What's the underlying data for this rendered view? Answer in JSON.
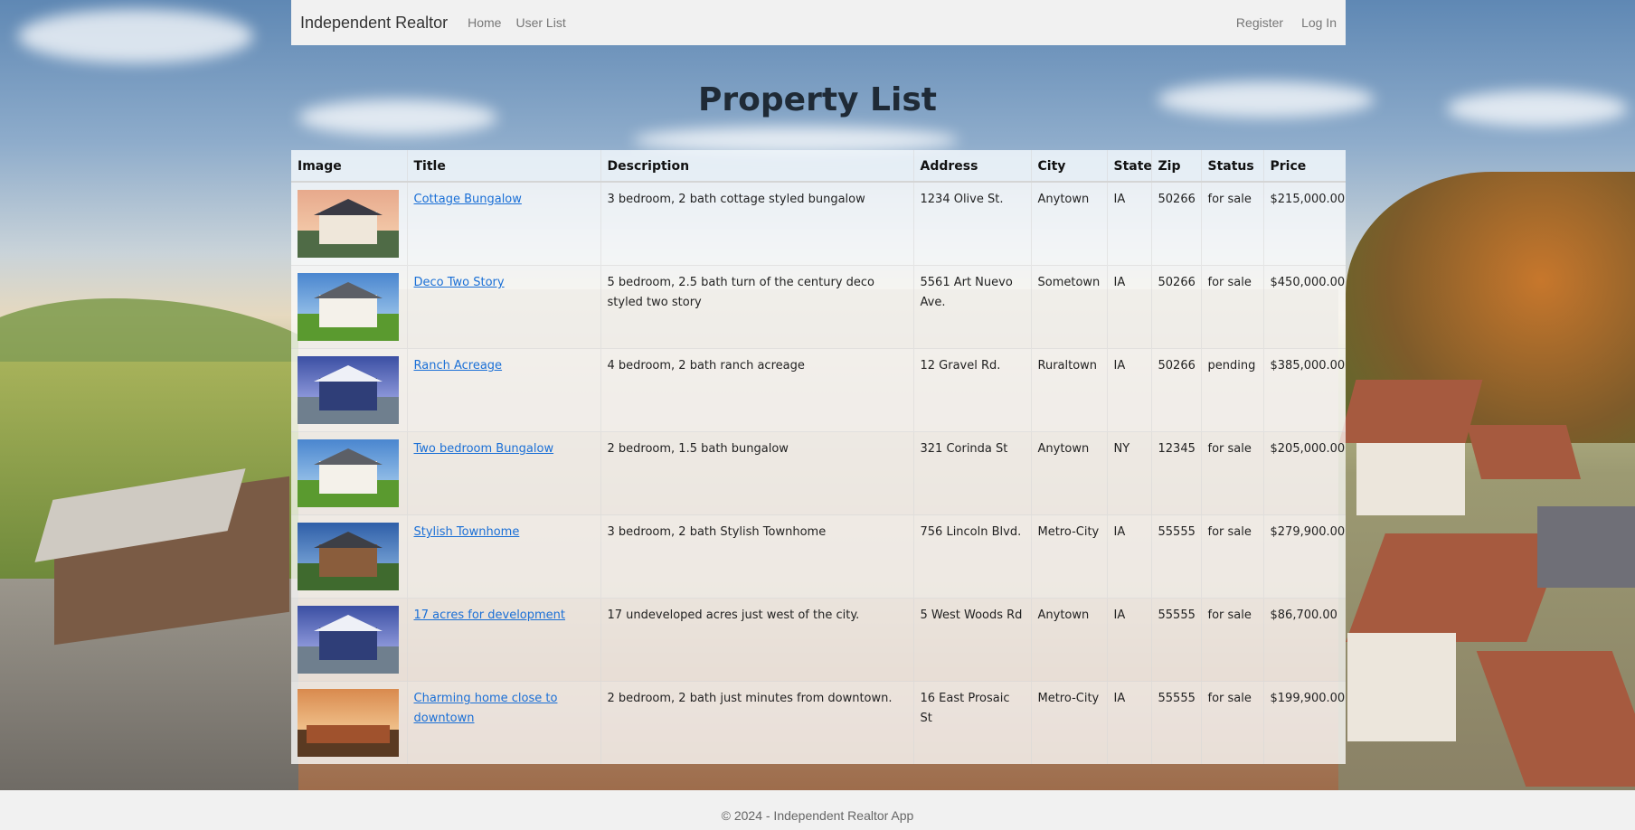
{
  "navbar": {
    "brand": "Independent Realtor",
    "links": [
      "Home",
      "User List"
    ],
    "right_links": [
      "Register",
      "Log In"
    ]
  },
  "page_title": "Property List",
  "table": {
    "headers": [
      "Image",
      "Title",
      "Description",
      "Address",
      "City",
      "State",
      "Zip",
      "Status",
      "Price"
    ],
    "rows": [
      {
        "title": "Cottage Bungalow",
        "description": "3 bedroom, 2 bath cottage styled bungalow",
        "address": "1234 Olive St.",
        "city": "Anytown",
        "state": "IA",
        "zip": "50266",
        "status": "for sale",
        "price": "$215,000.00"
      },
      {
        "title": "Deco Two Story",
        "description": "5 bedroom, 2.5 bath turn of the century deco styled two story",
        "address": "5561 Art Nuevo Ave.",
        "city": "Sometown",
        "state": "IA",
        "zip": "50266",
        "status": "for sale",
        "price": "$450,000.00"
      },
      {
        "title": "Ranch Acreage",
        "description": "4 bedroom, 2 bath ranch acreage",
        "address": "12 Gravel Rd.",
        "city": "Ruraltown",
        "state": "IA",
        "zip": "50266",
        "status": "pending",
        "price": "$385,000.00"
      },
      {
        "title": "Two bedroom Bungalow",
        "description": "2 bedroom, 1.5 bath bungalow",
        "address": "321 Corinda St",
        "city": "Anytown",
        "state": "NY",
        "zip": "12345",
        "status": "for sale",
        "price": "$205,000.00"
      },
      {
        "title": "Stylish Townhome",
        "description": "3 bedroom, 2 bath Stylish Townhome",
        "address": "756 Lincoln Blvd.",
        "city": "Metro-City",
        "state": "IA",
        "zip": "55555",
        "status": "for sale",
        "price": "$279,900.00"
      },
      {
        "title": "17 acres for development",
        "description": "17 undeveloped acres just west of the city.",
        "address": "5 West Woods Rd",
        "city": "Anytown",
        "state": "IA",
        "zip": "55555",
        "status": "for sale",
        "price": "$86,700.00"
      },
      {
        "title": "Charming home close to downtown",
        "description": "2 bedroom, 2 bath just minutes from downtown.",
        "address": "16 East Prosaic St",
        "city": "Metro-City",
        "state": "IA",
        "zip": "55555",
        "status": "for sale",
        "price": "$199,900.00"
      }
    ]
  },
  "footer": "© 2024 - Independent Realtor App",
  "colors": {
    "link": "#1a6fd6",
    "navbar_bg": "#f1f1f1",
    "title_text": "#1f2a36"
  }
}
